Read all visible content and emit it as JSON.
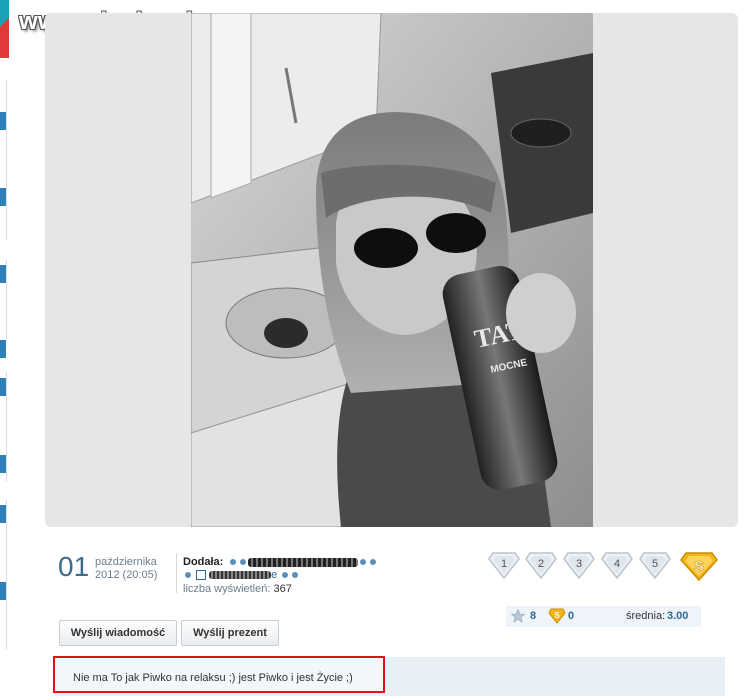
{
  "watermark": "www.wiocha.pl",
  "post": {
    "day": "01",
    "month": "października",
    "year_time": "2012 (20:05)",
    "added_label": "Dodała:",
    "author_suffix": "e",
    "views_label": "liczba wyświetleń:",
    "views": "367"
  },
  "rating": {
    "badges": [
      "1",
      "2",
      "3",
      "4",
      "5"
    ],
    "super_badge": "S",
    "star_count": "8",
    "super_count": "0",
    "average_label": "średnia:",
    "average_value": "3.00"
  },
  "actions": {
    "send_message": "Wyślij wiadomość",
    "send_gift": "Wyślij prezent"
  },
  "comment": {
    "text": "Nie ma To jak Piwko na relaksu ;) jest Piwko i jest Życie ;)"
  },
  "photo": {
    "bottle_label": "TATRA",
    "bottle_sub": "MOCNE"
  },
  "colors": {
    "accent": "#2f6a97",
    "highlight": "#e0111b",
    "badge_gold": "#f2b51c"
  }
}
